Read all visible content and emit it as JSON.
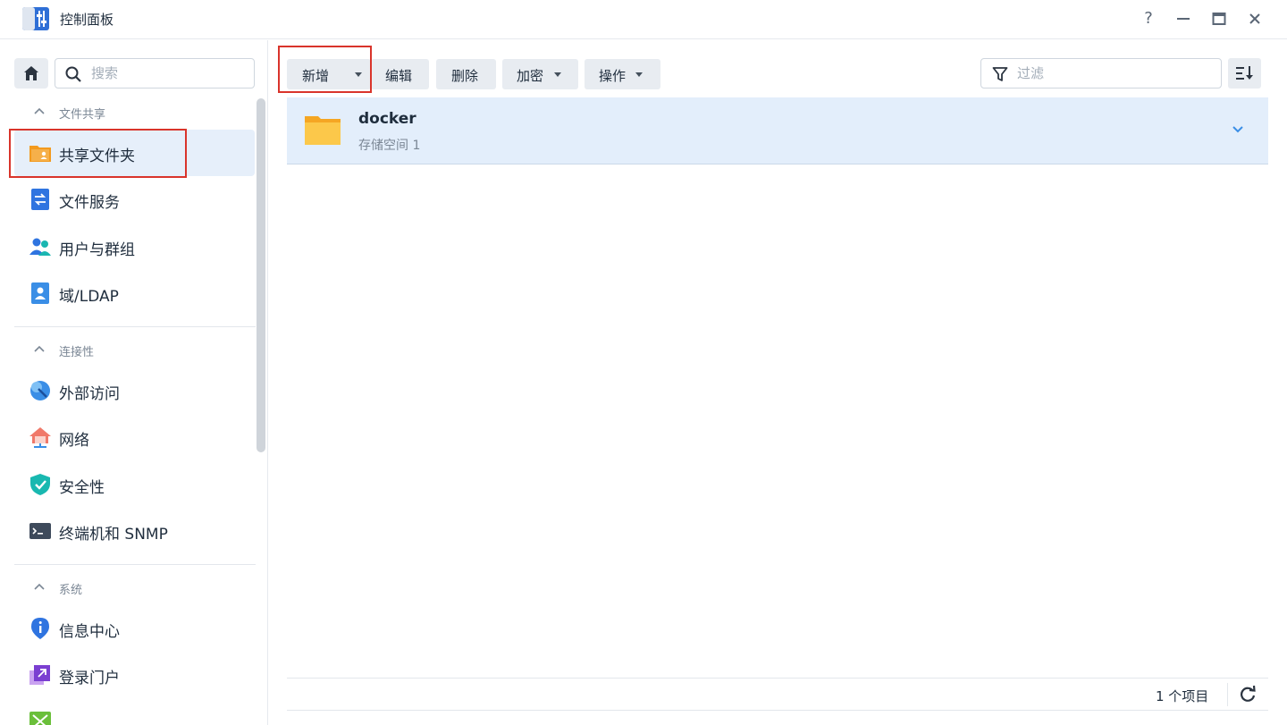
{
  "window": {
    "title": "控制面板",
    "help": "?",
    "minimize": "–",
    "close": "✕"
  },
  "sidebar": {
    "search_placeholder": "搜索",
    "sections": [
      {
        "header": "文件共享",
        "items": [
          {
            "label": "共享文件夹",
            "icon": "shared-folder-icon",
            "selected": true
          },
          {
            "label": "文件服务",
            "icon": "file-services-icon"
          },
          {
            "label": "用户与群组",
            "icon": "users-groups-icon"
          },
          {
            "label": "域/LDAP",
            "icon": "domain-ldap-icon"
          }
        ]
      },
      {
        "header": "连接性",
        "items": [
          {
            "label": "外部访问",
            "icon": "external-access-icon"
          },
          {
            "label": "网络",
            "icon": "network-icon"
          },
          {
            "label": "安全性",
            "icon": "security-shield-icon"
          },
          {
            "label": "终端机和 SNMP",
            "icon": "terminal-icon"
          }
        ]
      },
      {
        "header": "系统",
        "items": [
          {
            "label": "信息中心",
            "icon": "info-center-icon"
          },
          {
            "label": "登录门户",
            "icon": "login-portal-icon"
          }
        ]
      }
    ]
  },
  "toolbar": {
    "create": "新增",
    "edit": "编辑",
    "delete": "删除",
    "encrypt": "加密",
    "action": "操作",
    "filter_placeholder": "过滤"
  },
  "folders": [
    {
      "name": "docker",
      "volume": "存储空间 1"
    }
  ],
  "footer": {
    "item_count": "1 个项目"
  },
  "colors": {
    "accent": "#3a8ee6",
    "selected_bg": "#e6effa",
    "highlight": "#d9342b"
  }
}
